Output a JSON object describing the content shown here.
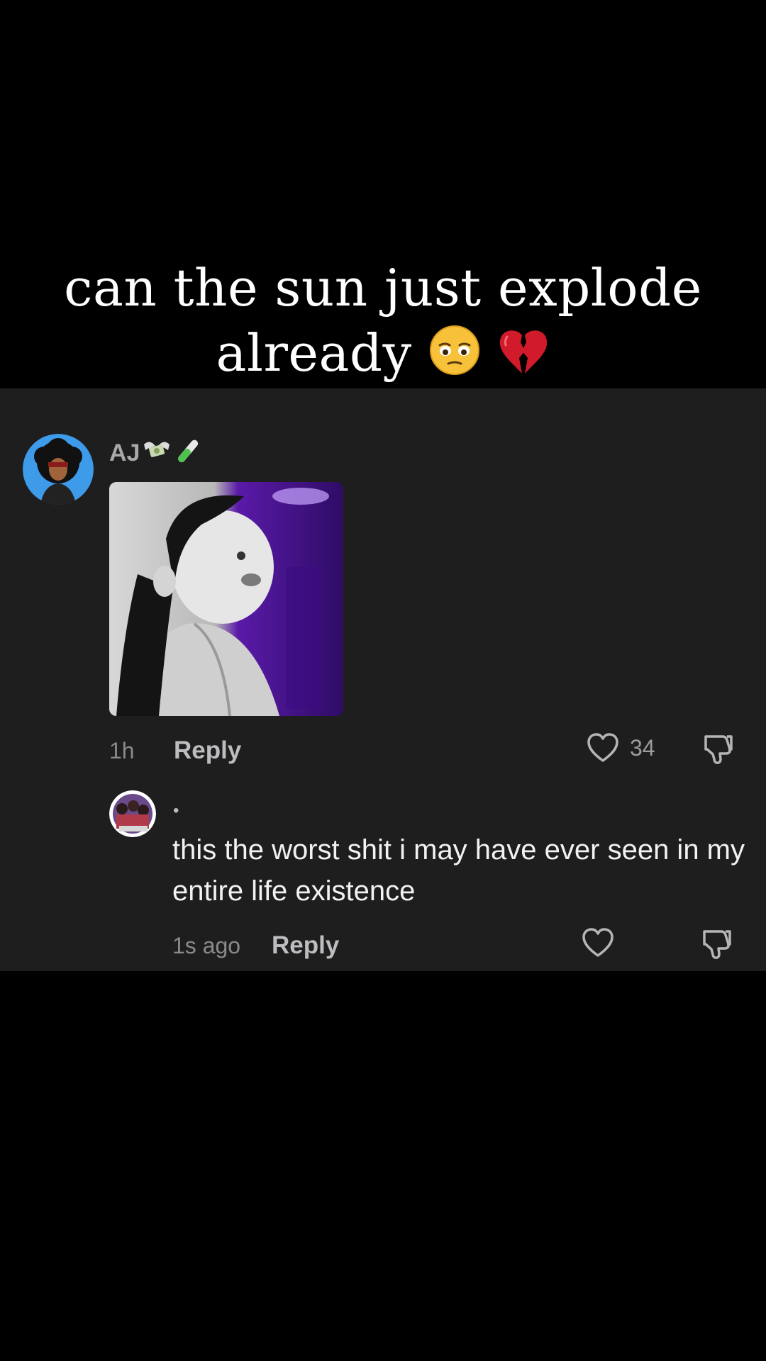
{
  "caption": {
    "line1": "can the sun just explode",
    "line2": "already",
    "emojis": [
      "pensive-face",
      "broken-heart"
    ]
  },
  "comment": {
    "username": "AJ",
    "username_emojis": [
      "money-with-wings",
      "test-tube"
    ],
    "avatar": "cartoon-afro-avatar",
    "media": "baby-looking-up-photo",
    "time": "1h",
    "reply_label": "Reply",
    "like_count": "34"
  },
  "reply": {
    "username": "•",
    "avatar": "group-photo-avatar",
    "text": "this the worst shit i may have ever seen in my entire life existence",
    "time": "1s ago",
    "reply_label": "Reply"
  },
  "colors": {
    "background": "#000000",
    "panel": "#1e1e1f",
    "muted_text": "#8a8a8d",
    "reply_text": "#f2f2f2"
  }
}
